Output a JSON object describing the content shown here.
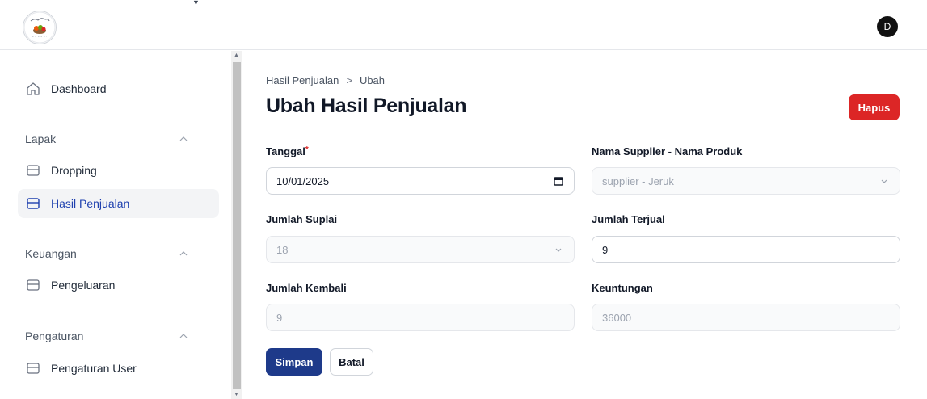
{
  "header": {
    "logo_icon": "store-logo-icon",
    "avatar_initial": "D",
    "caret_icon": "caret-down-icon"
  },
  "sidebar": {
    "dashboard": {
      "label": "Dashboard",
      "icon": "home-icon"
    },
    "groups": [
      {
        "label": "Lapak",
        "chevron_icon": "chevron-up-icon",
        "items": [
          {
            "label": "Dropping",
            "icon": "inbox-icon"
          },
          {
            "label": "Hasil Penjualan",
            "icon": "inbox-icon",
            "active": true
          }
        ]
      },
      {
        "label": "Keuangan",
        "chevron_icon": "chevron-up-icon",
        "items": [
          {
            "label": "Pengeluaran",
            "icon": "inbox-icon"
          }
        ]
      },
      {
        "label": "Pengaturan",
        "chevron_icon": "chevron-up-icon",
        "items": [
          {
            "label": "Pengaturan User",
            "icon": "inbox-icon"
          }
        ]
      }
    ]
  },
  "breadcrumb": {
    "parent": "Hasil Penjualan",
    "separator": ">",
    "current": "Ubah"
  },
  "page": {
    "title": "Ubah Hasil Penjualan",
    "delete_label": "Hapus"
  },
  "form": {
    "tanggal": {
      "label": "Tanggal",
      "required_mark": "*",
      "value": "10/01/2025",
      "icon": "calendar-icon"
    },
    "supplier_produk": {
      "label": "Nama Supplier - Nama Produk",
      "value": "supplier - Jeruk",
      "disabled": true,
      "icon": "chevron-down-icon"
    },
    "jumlah_suplai": {
      "label": "Jumlah Suplai",
      "value": "18",
      "disabled": true,
      "icon": "chevron-down-icon"
    },
    "jumlah_terjual": {
      "label": "Jumlah Terjual",
      "value": "9"
    },
    "jumlah_kembali": {
      "label": "Jumlah Kembali",
      "value": "9",
      "disabled": true
    },
    "keuntungan": {
      "label": "Keuntungan",
      "value": "36000",
      "disabled": true
    }
  },
  "actions": {
    "save_label": "Simpan",
    "cancel_label": "Batal"
  },
  "colors": {
    "primary": "#1e3a8a",
    "danger": "#dc2626",
    "active_text": "#1e40af",
    "active_bg": "#f3f4f6"
  }
}
